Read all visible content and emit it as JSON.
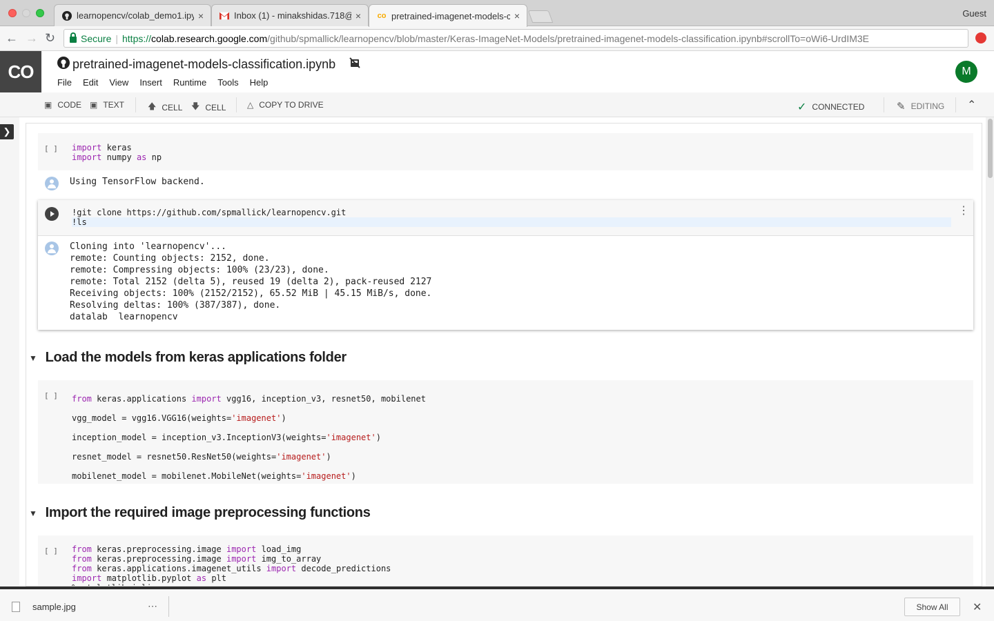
{
  "browser": {
    "tabs": [
      {
        "title": "learnopencv/colab_demo1.ipyn",
        "close": "×",
        "icon": "github-icon"
      },
      {
        "title": "Inbox (1) - minakshidas.718@g",
        "close": "×",
        "icon": "gmail-icon"
      },
      {
        "title": "pretrained-imagenet-models-c",
        "close": "×",
        "icon": "colab-icon"
      }
    ],
    "profile": "Guest",
    "secure_label": "Secure",
    "url_scheme": "https://",
    "url_host": "colab.research.google.com",
    "url_path": "/github/spmallick/learnopencv/blob/master/Keras-ImageNet-Models/pretrained-imagenet-models-classification.ipynb#scrollTo=oWi6-UrdIM3E"
  },
  "colab": {
    "logo": "CO",
    "notebook_title": "pretrained-imagenet-models-classification.ipynb",
    "menu": [
      "File",
      "Edit",
      "View",
      "Insert",
      "Runtime",
      "Tools",
      "Help"
    ],
    "avatar_initial": "M",
    "toolbar": {
      "add_code": "CODE",
      "add_text": "TEXT",
      "cell_up": "CELL",
      "cell_down": "CELL",
      "copy_to_drive": "COPY TO DRIVE",
      "status": "CONNECTED",
      "mode": "EDITING"
    }
  },
  "cells": {
    "prompt": "[ ]",
    "output1": "Using TensorFlow backend.",
    "output2": "Cloning into 'learnopencv'...\nremote: Counting objects: 2152, done.\nremote: Compressing objects: 100% (23/23), done.\nremote: Total 2152 (delta 5), reused 19 (delta 2), pack-reused 2127\nReceiving objects: 100% (2152/2152), 65.52 MiB | 45.15 MiB/s, done.\nResolving deltas: 100% (387/387), done.\ndatalab  learnopencv",
    "heading1": "Load the models from keras applications folder",
    "heading2": "Import the required image preprocessing functions"
  },
  "download": {
    "file": "sample.jpg",
    "more": "⋯",
    "show_all": "Show All"
  },
  "colors": {
    "keyword": "#9c27b0",
    "string": "#b71c1c",
    "secure": "#0b8043",
    "avatar": "#0a7a2a"
  }
}
